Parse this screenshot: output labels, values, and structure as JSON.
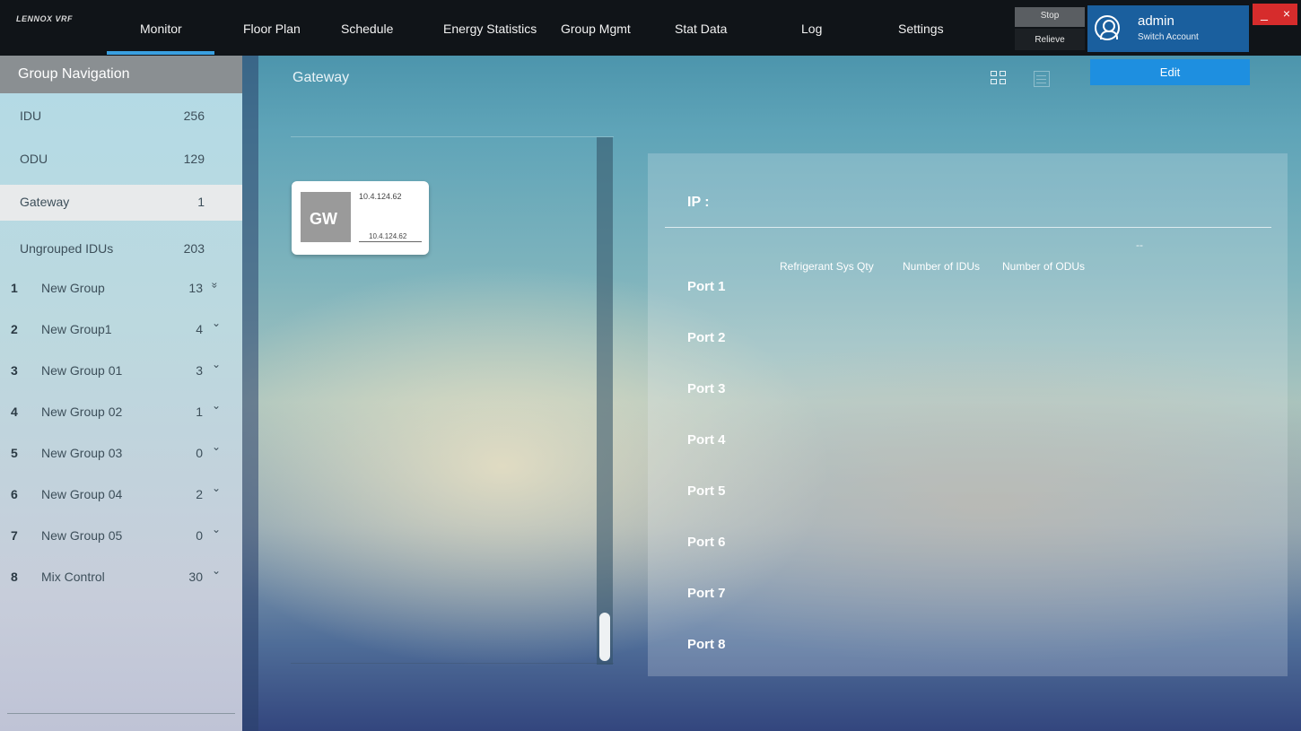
{
  "topbar": {
    "logo": "LENNOX VRF",
    "tabs": [
      {
        "label": "Monitor"
      },
      {
        "label": "Floor Plan"
      },
      {
        "label": "Schedule"
      },
      {
        "label": "Energy Statistics"
      },
      {
        "label": "Group Mgmt"
      },
      {
        "label": "Stat Data"
      },
      {
        "label": "Log"
      },
      {
        "label": "Settings"
      }
    ],
    "active_tab": "Monitor",
    "stop_label": "Stop",
    "relieve_label": "Relieve",
    "account": {
      "user": "admin",
      "switch_label": "Switch Account"
    },
    "minimize": "_",
    "close": "×",
    "accent_color": "#1a5f9e"
  },
  "sidebar": {
    "title": "Group Navigation",
    "items": [
      {
        "label": "IDU",
        "count": "256"
      },
      {
        "label": "ODU",
        "count": "129"
      },
      {
        "label": "Gateway",
        "count": "1",
        "selected": true
      },
      {
        "label": "Ungrouped IDUs",
        "count": "203"
      }
    ],
    "groups": [
      {
        "num": "1",
        "label": "New Group",
        "count": "13",
        "chevron": "»"
      },
      {
        "num": "2",
        "label": "New Group1",
        "count": "4",
        "chevron": "⌄"
      },
      {
        "num": "3",
        "label": "New Group 01",
        "count": "3",
        "chevron": "⌄"
      },
      {
        "num": "4",
        "label": "New Group 02",
        "count": "1",
        "chevron": "⌄"
      },
      {
        "num": "5",
        "label": "New Group 03",
        "count": "0",
        "chevron": "⌄"
      },
      {
        "num": "6",
        "label": "New Group 04",
        "count": "2",
        "chevron": "⌄"
      },
      {
        "num": "7",
        "label": "New Group 05",
        "count": "0",
        "chevron": "⌄"
      },
      {
        "num": "8",
        "label": "Mix Control",
        "count": "30",
        "chevron": "⌄"
      }
    ]
  },
  "main": {
    "breadcrumb": "Gateway",
    "edit_label": "Edit",
    "gateway_card": {
      "badge": "GW",
      "ip_top": "10.4.124.62",
      "ip_bottom": "10.4.124.62"
    },
    "details": {
      "ip_label": "IP :",
      "dashes": "--",
      "columns": [
        "Refrigerant Sys Qty",
        "Number of IDUs",
        "Number of ODUs"
      ],
      "ports": [
        "Port 1",
        "Port 2",
        "Port 3",
        "Port 4",
        "Port 5",
        "Port 6",
        "Port 7",
        "Port 8"
      ]
    }
  }
}
